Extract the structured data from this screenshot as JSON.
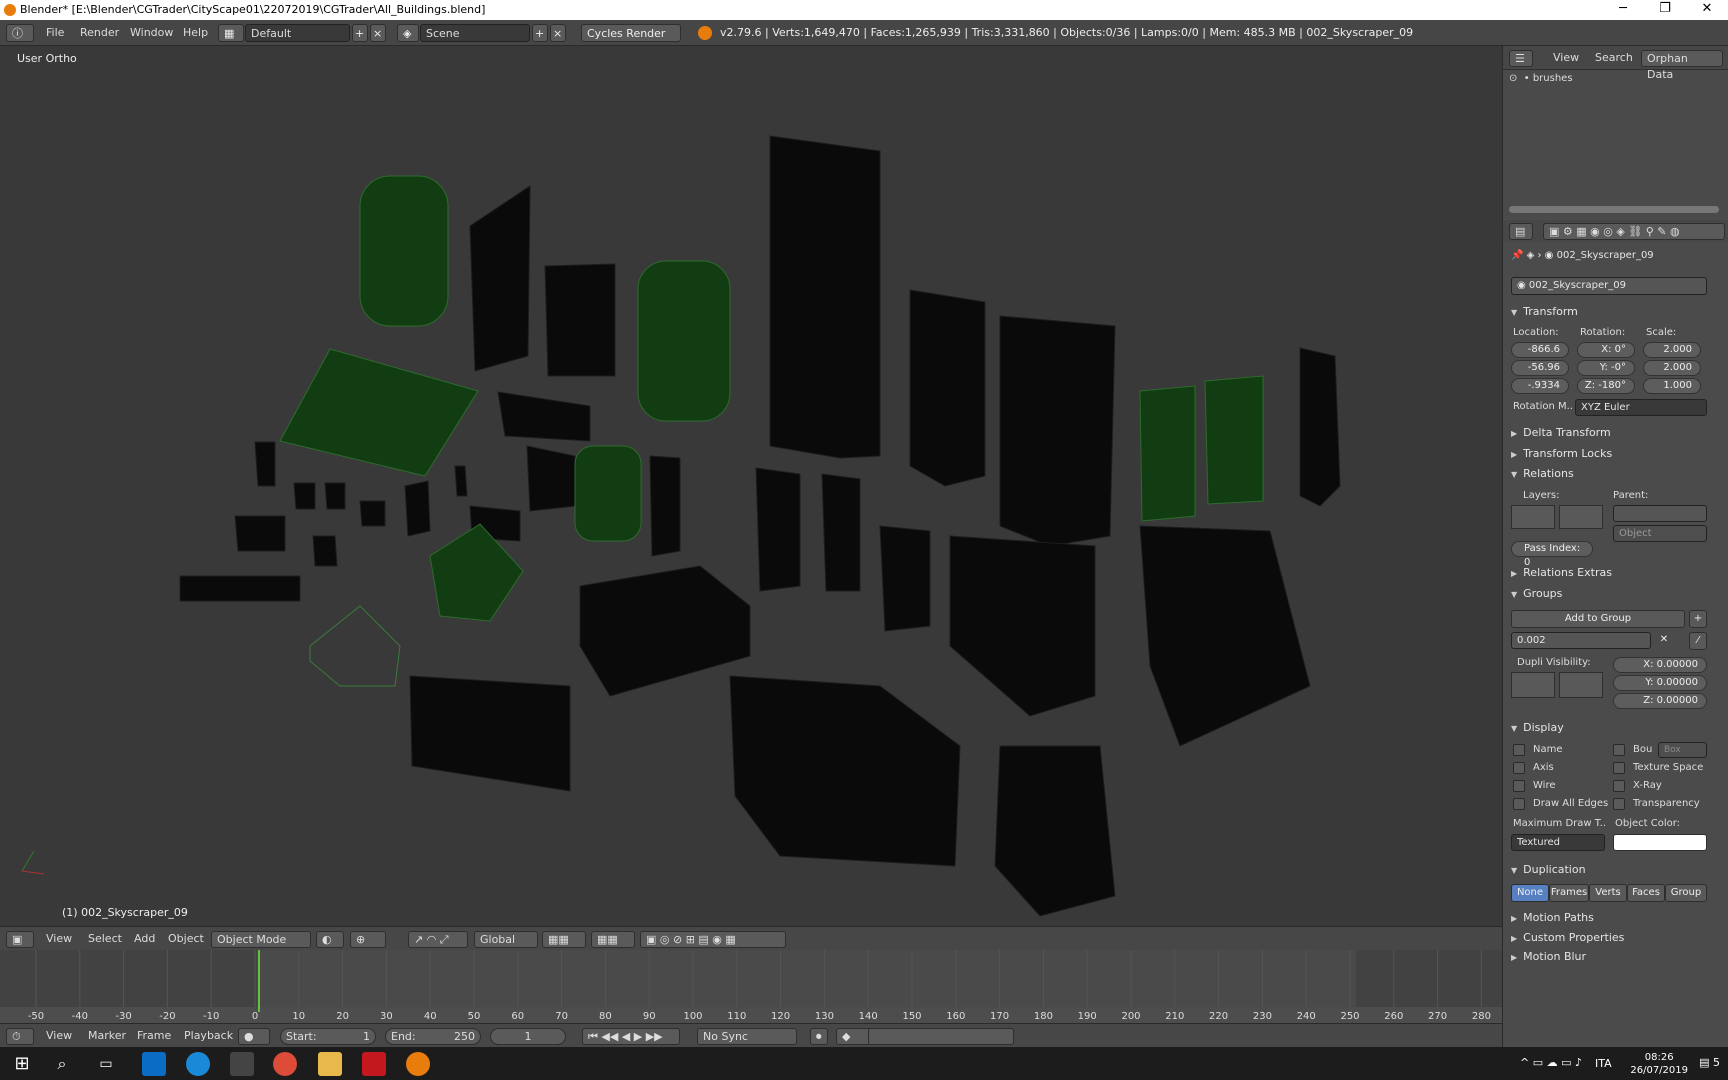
{
  "window": {
    "title": "Blender* [E:\\Blender\\CGTrader\\CityScape01\\22072019\\CGTrader\\All_Buildings.blend]",
    "min": "─",
    "max": "❐",
    "close": "✕"
  },
  "menu": [
    "File",
    "Render",
    "Window",
    "Help"
  ],
  "screen_layout": "Default",
  "scene": "Scene",
  "render_engine": "Cycles Render",
  "stats": "v2.79.6 | Verts:1,649,470 | Faces:1,265,939 | Tris:3,331,860 | Objects:0/36 | Lamps:0/0 | Mem: 485.3 MB | 002_Skyscraper_09",
  "viewport": {
    "view_label": "User Ortho",
    "object_label": "(1) 002_Skyscraper_09"
  },
  "viewport_header": {
    "items": [
      "View",
      "Select",
      "Add",
      "Object"
    ],
    "mode": "Object Mode",
    "orientation": "Global"
  },
  "timeline": {
    "ticks": [
      "-50",
      "-40",
      "-30",
      "-20",
      "-10",
      "0",
      "10",
      "20",
      "30",
      "40",
      "50",
      "60",
      "70",
      "80",
      "90",
      "100",
      "110",
      "120",
      "130",
      "140",
      "150",
      "160",
      "170",
      "180",
      "190",
      "200",
      "210",
      "220",
      "230",
      "240",
      "250",
      "260",
      "270",
      "280"
    ],
    "current_frame": 0
  },
  "timeline_header": {
    "items": [
      "View",
      "Marker",
      "Frame",
      "Playback"
    ],
    "start": "Start:",
    "start_val": "1",
    "end": "End:",
    "end_val": "250",
    "frame": "1",
    "sync": "No Sync"
  },
  "outliner": {
    "tabs": [
      "View",
      "Search",
      "Orphan Data"
    ],
    "item": "brushes"
  },
  "properties": {
    "object_path": "002_Skyscraper_09",
    "object_name": "002_Skyscraper_09",
    "transform": "Transform",
    "location_label": "Location:",
    "rotation_label": "Rotation:",
    "scale_label": "Scale:",
    "location": [
      "-866.6",
      "-56.96",
      "-.9334"
    ],
    "rotation": [
      "X: 0°",
      "Y: -0°",
      "Z: -180°"
    ],
    "scale": [
      "2.000",
      "2.000",
      "1.000"
    ],
    "rotation_mode_label": "Rotation M..",
    "rotation_mode": "XYZ Euler",
    "delta": "Delta Transform",
    "locks": "Transform Locks",
    "relations": "Relations",
    "layers_label": "Layers:",
    "parent_label": "Parent:",
    "parent_type": "Object",
    "pass_index": "Pass Index:",
    "pass_val": "0",
    "relations_extras": "Relations Extras",
    "groups": "Groups",
    "add_group": "Add to Group",
    "group_name": "0.002",
    "dupli_vis": "Dupli Visibility:",
    "dupli": [
      "X: 0.00000",
      "Y: 0.00000",
      "Z: 0.00000"
    ],
    "display": "Display",
    "checks": [
      "Name",
      "Axis",
      "Wire",
      "Draw All Edges"
    ],
    "checks2": [
      "Bou",
      "Texture Space",
      "X-Ray",
      "Transparency"
    ],
    "box": "Box",
    "max_draw": "Maximum Draw T..",
    "max_draw_val": "Textured",
    "obj_color": "Object Color:",
    "duplication": "Duplication",
    "dup_btns": [
      "None",
      "Frames",
      "Verts",
      "Faces",
      "Group"
    ],
    "motion_paths": "Motion Paths",
    "custom_props": "Custom Properties",
    "motion_blur": "Motion Blur"
  },
  "taskbar": {
    "lang": "ITA",
    "time": "08:26",
    "date": "26/07/2019",
    "notif": "5"
  }
}
